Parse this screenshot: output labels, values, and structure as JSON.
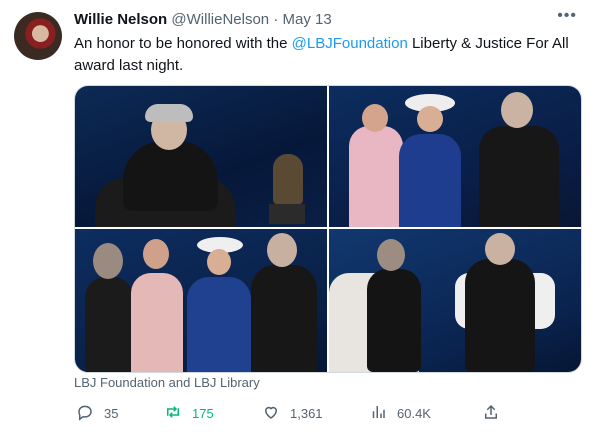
{
  "tweet": {
    "author_name": "Willie Nelson",
    "handle": "@WillieNelson",
    "separator": "·",
    "date": "May 13",
    "text_before": "An honor to be honored with the ",
    "mention": "@LBJFoundation",
    "text_after": " Liberty & Justice For All award last night.",
    "media_credit": "LBJ Foundation and LBJ Library"
  },
  "actions": {
    "replies": "35",
    "retweets": "175",
    "likes": "1,361",
    "views": "60.4K"
  },
  "colors": {
    "link": "#1d9bf0",
    "retweet": "#00ba7c",
    "muted": "#536471"
  },
  "icons": [
    "more-icon",
    "reply-icon",
    "retweet-icon",
    "like-icon",
    "views-icon",
    "share-icon"
  ]
}
